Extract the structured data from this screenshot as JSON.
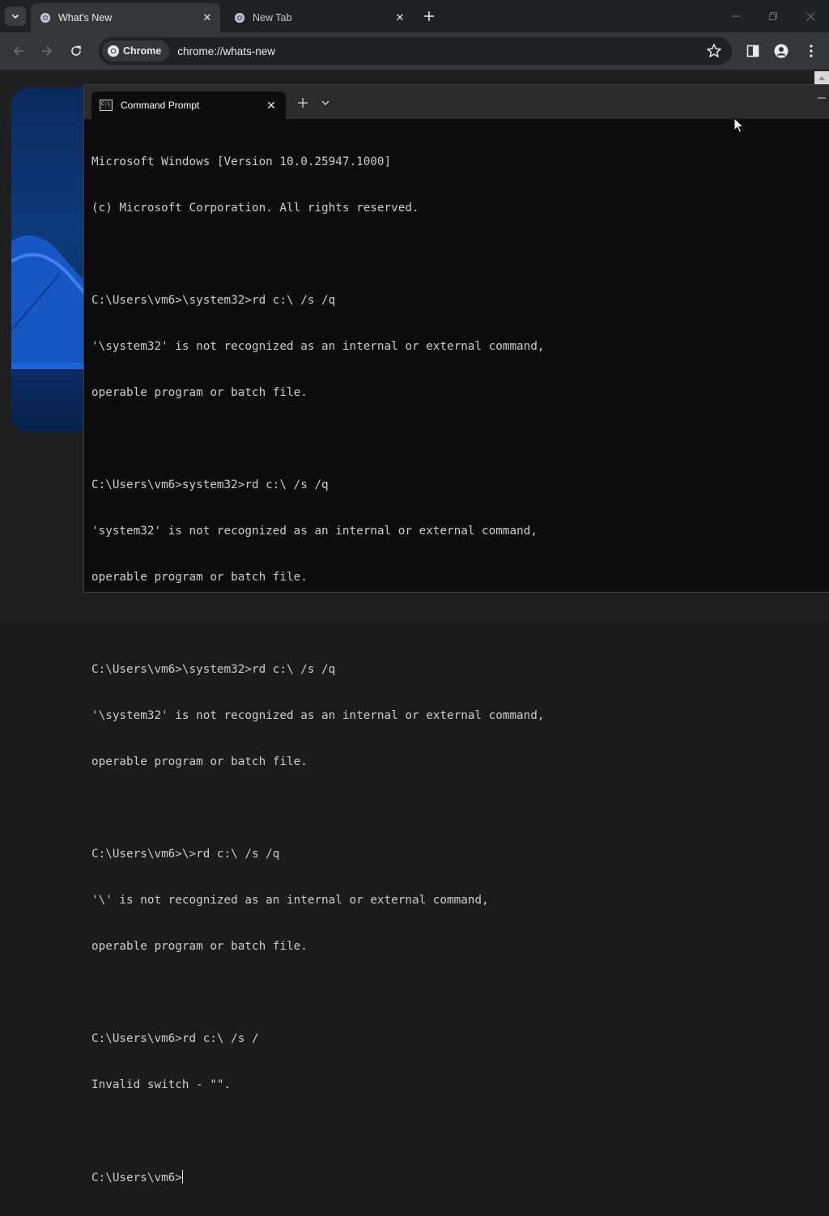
{
  "browser": {
    "tabs": [
      {
        "title": "What's New",
        "active": true
      },
      {
        "title": "New Tab",
        "active": false
      }
    ],
    "toolbar": {
      "chip_label": "Chrome",
      "url": "chrome://whats-new"
    }
  },
  "terminal": {
    "tab_title": "Command Prompt",
    "lines": [
      "Microsoft Windows [Version 10.0.25947.1000]",
      "(c) Microsoft Corporation. All rights reserved.",
      "",
      "C:\\Users\\vm6>\\system32>rd c:\\ /s /q",
      "'\\system32' is not recognized as an internal or external command,",
      "operable program or batch file.",
      "",
      "C:\\Users\\vm6>system32>rd c:\\ /s /q",
      "'system32' is not recognized as an internal or external command,",
      "operable program or batch file.",
      "",
      "C:\\Users\\vm6>\\system32>rd c:\\ /s /q",
      "'\\system32' is not recognized as an internal or external command,",
      "operable program or batch file.",
      "",
      "C:\\Users\\vm6>\\>rd c:\\ /s /q",
      "'\\' is not recognized as an internal or external command,",
      "operable program or batch file.",
      "",
      "C:\\Users\\vm6>rd c:\\ /s /",
      "Invalid switch - \"\".",
      ""
    ],
    "prompt": "C:\\Users\\vm6>"
  },
  "colors": {
    "terminal_bg": "#0c0c0c",
    "terminal_fg": "#cccccc",
    "chrome_frame": "#202124",
    "chrome_toolbar": "#35363a"
  }
}
